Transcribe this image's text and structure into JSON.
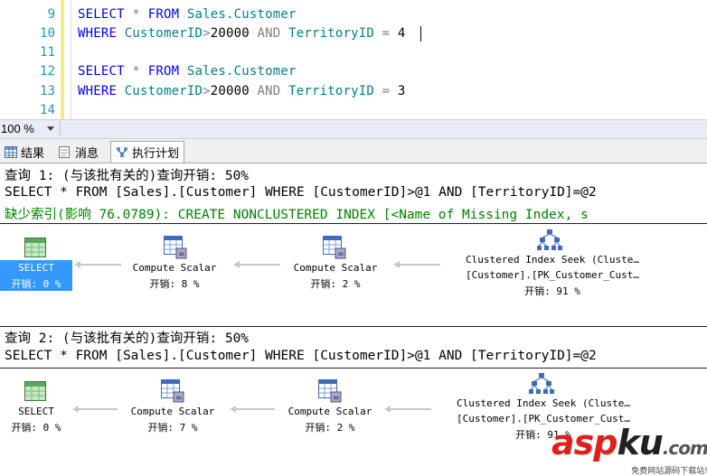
{
  "editor": {
    "line_numbers": [
      "9",
      "10",
      "11",
      "12",
      "13",
      "14"
    ],
    "lines": [
      {
        "kw1": "SELECT",
        "op": "*",
        "kw2": "FROM",
        "table": "Sales.Customer"
      },
      {
        "kw1": "WHERE",
        "col1": "CustomerID",
        "op1": ">",
        "v1": "20000",
        "kw2": "AND",
        "col2": "TerritoryID",
        "op2": "=",
        "v2": "4"
      },
      {},
      {
        "kw1": "SELECT",
        "op": "*",
        "kw2": "FROM",
        "table": "Sales.Customer"
      },
      {
        "kw1": "WHERE",
        "col1": "CustomerID",
        "op1": ">",
        "v1": "20000",
        "kw2": "AND",
        "col2": "TerritoryID",
        "op2": "=",
        "v2": "3"
      },
      {}
    ]
  },
  "zoom": {
    "label": "100 %"
  },
  "tabs": [
    {
      "label": "结果",
      "icon": "grid-icon"
    },
    {
      "label": "消息",
      "icon": "message-icon"
    },
    {
      "label": "执行计划",
      "icon": "execution-plan-icon"
    }
  ],
  "plan": {
    "queries": [
      {
        "header": "查询 1: (与该批有关的)查询开销: 50%",
        "sql": "SELECT * FROM [Sales].[Customer] WHERE [CustomerID]>@1 AND [TerritoryID]=@2",
        "missing_index": "缺少索引(影响 76.0789): CREATE NONCLUSTERED INDEX [<Name of Missing Index, s",
        "nodes": [
          {
            "name": "SELECT",
            "cost": "开销: 0 %"
          },
          {
            "name": "Compute Scalar",
            "cost": "开销: 8 %"
          },
          {
            "name": "Compute Scalar",
            "cost": "开销: 2 %"
          },
          {
            "name": "Clustered Index Seek (Cluste…",
            "detail": "[Customer].[PK_Customer_Cust…",
            "cost": "开销: 91 %"
          }
        ]
      },
      {
        "header": "查询 2: (与该批有关的)查询开销: 50%",
        "sql": "SELECT * FROM [Sales].[Customer] WHERE [CustomerID]>@1 AND [TerritoryID]=@2",
        "nodes": [
          {
            "name": "SELECT",
            "cost": "开销: 0 %"
          },
          {
            "name": "Compute Scalar",
            "cost": "开销: 7 %"
          },
          {
            "name": "Compute Scalar",
            "cost": "开销: 2 %"
          },
          {
            "name": "Clustered Index Seek (Cluste…",
            "detail": "[Customer].[PK_Customer_Cust…",
            "cost": "开销: 91 %"
          }
        ]
      }
    ]
  },
  "watermark": {
    "brand_red": "asp",
    "brand_dark": "ku",
    "suffix": ".com",
    "sub": "免费网站源码下载站!"
  }
}
